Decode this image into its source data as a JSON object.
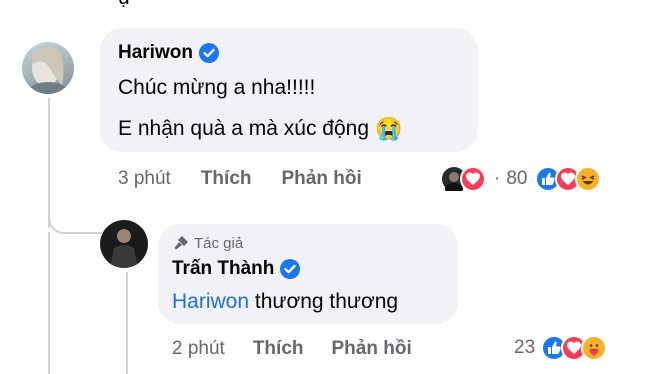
{
  "top_fragment": "ự",
  "comment1": {
    "author": "Hariwon",
    "line1": "Chúc mừng a nha!!!!!",
    "line2": "E nhận quà a mà xúc động",
    "emoji": "😭",
    "time": "3 phút",
    "like": "Thích",
    "reply": "Phản hồi",
    "middot": "·",
    "count": "80"
  },
  "comment2": {
    "badge": "Tác giả",
    "author": "Trấn Thành",
    "mention": "Hariwon",
    "text": "thương thương",
    "time": "2 phút",
    "like": "Thích",
    "reply": "Phản hồi",
    "count": "23"
  },
  "colors": {
    "link": "#216fdb",
    "like": "#1877f2",
    "love": "#f33e58",
    "haha": "#f7b125",
    "bubble": "#f0f2f5",
    "meta": "#65676b"
  },
  "icons": [
    "verified-badge-icon",
    "microphone-icon",
    "like-reaction-icon",
    "love-reaction-icon",
    "haha-reaction-icon",
    "care-reaction-icon"
  ]
}
